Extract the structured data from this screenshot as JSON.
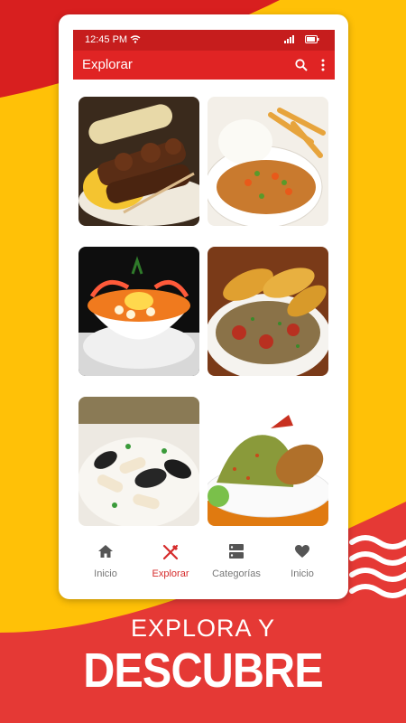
{
  "status_bar": {
    "time": "12:45 PM",
    "icons": [
      "wifi-icon",
      "signal-icon",
      "battery-icon"
    ]
  },
  "app_bar": {
    "title": "Explorar",
    "icons": [
      "search-icon",
      "more-vert-icon"
    ]
  },
  "dishes": [
    {
      "name": "anticuchos-dish",
      "description": "grilled skewers with corn"
    },
    {
      "name": "tallarin-dish",
      "description": "stew with rice and fries"
    },
    {
      "name": "chupe-dish",
      "description": "shrimp soup bowl"
    },
    {
      "name": "tacu-tacu-dish",
      "description": "rice with fried plantains"
    },
    {
      "name": "seafood-dish",
      "description": "mussels and squid"
    },
    {
      "name": "arroz-con-pato-dish",
      "description": "green rice with duck"
    }
  ],
  "nav": {
    "items": [
      {
        "label": "Inicio",
        "icon": "home-icon",
        "active": false
      },
      {
        "label": "Explorar",
        "icon": "utensils-icon",
        "active": true
      },
      {
        "label": "Categorías",
        "icon": "categories-icon",
        "active": false
      },
      {
        "label": "Inicio",
        "icon": "heart-icon",
        "active": false
      }
    ]
  },
  "promo": {
    "line1": "EXPLORA Y",
    "line2": "DESCUBRE"
  },
  "colors": {
    "brand_red": "#e02424",
    "status_red": "#c61d1d",
    "yellow": "#ffc107",
    "nav_active": "#d62b2b"
  }
}
